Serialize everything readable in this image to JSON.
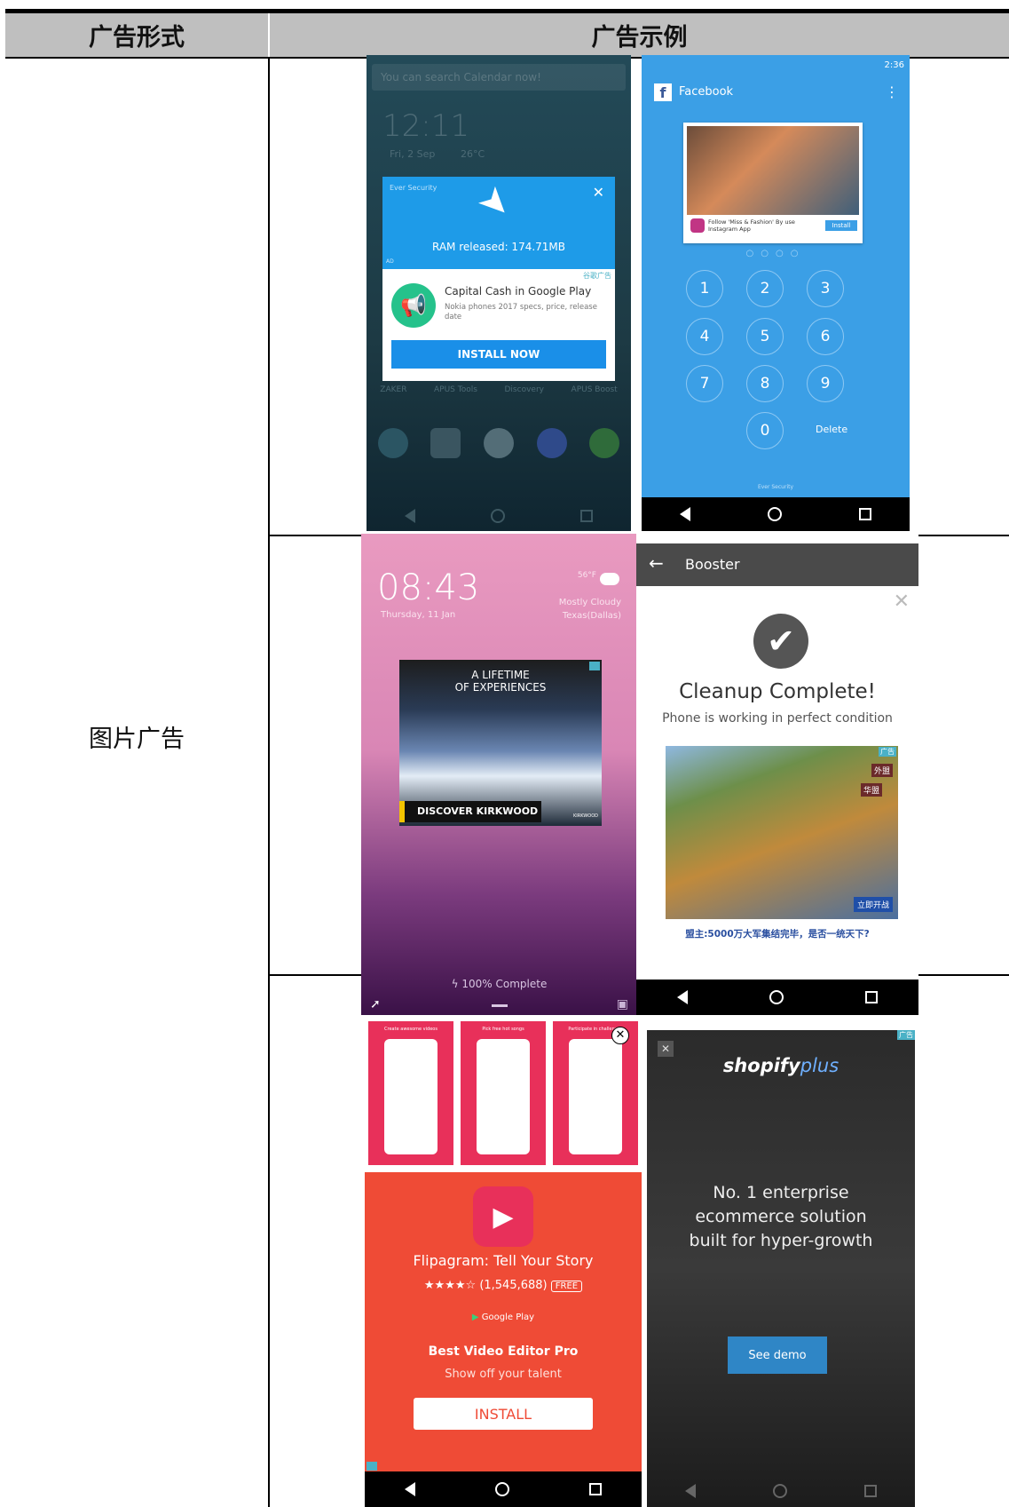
{
  "header": {
    "col1": "广告形式",
    "col2": "广告示例"
  },
  "format_label": "图片广告",
  "shot1": {
    "search": "You can search Calendar now!",
    "time": "12:11",
    "date": "Fri, 2 Sep",
    "temp": "26°C",
    "card_brand": "Ever Security",
    "ram": "RAM released: 174.71MB",
    "ad_tag": "AD",
    "ad_label": "谷歌广告",
    "ad_title": "Capital Cash in Google Play",
    "ad_desc": "Nokia phones 2017 specs, price, release date",
    "install": "INSTALL NOW",
    "dock": [
      "ZAKER",
      "APUS Tools",
      "Discovery",
      "APUS Boost"
    ]
  },
  "shot2": {
    "clock": "2:36",
    "app": "Facebook",
    "ig_text": "Follow 'Miss & Fashion' By use Instagram App",
    "ig_install": "Install",
    "keys": [
      "1",
      "2",
      "3",
      "4",
      "5",
      "6",
      "7",
      "8",
      "9"
    ],
    "zero": "0",
    "delete": "Delete",
    "footer": "Ever Security"
  },
  "shot3": {
    "time": "08:43",
    "date": "Thursday, 11 Jan",
    "temp": "56°F",
    "weather": "Mostly Cloudy",
    "loc": "Texas(Dallas)",
    "ad_line1": "A LIFETIME",
    "ad_line2": "OF EXPERIENCES",
    "ad_cta": "DISCOVER KIRKWOOD",
    "ad_brand": "KIRKWOOD",
    "charge": "100% Complete"
  },
  "shot4": {
    "title": "Booster",
    "done": "Cleanup Complete!",
    "sub": "Phone is working in perfect condition",
    "ad_label": "广告",
    "game_tags": [
      "外盟",
      "华盟"
    ],
    "game_btn": "立即开战",
    "caption": "盟主:5000万大军集结完毕，是否一统天下?"
  },
  "shot5": {
    "banners": [
      "Create awesome videos",
      "Pick free hot songs",
      "Participate in challenges"
    ],
    "name": "Flipagram: Tell Your Story",
    "rating": "★★★★☆",
    "count": "(1,545,688)",
    "free": "FREE",
    "store": "Google Play",
    "headline": "Best Video Editor Pro",
    "tagline": "Show off your talent",
    "install": "INSTALL"
  },
  "shot6": {
    "ad_label": "广告",
    "brand1": "shopify",
    "brand2": "plus",
    "l1": "No. 1 enterprise",
    "l2": "ecommerce solution",
    "l3": "built for hyper-growth",
    "cta": "See demo"
  }
}
